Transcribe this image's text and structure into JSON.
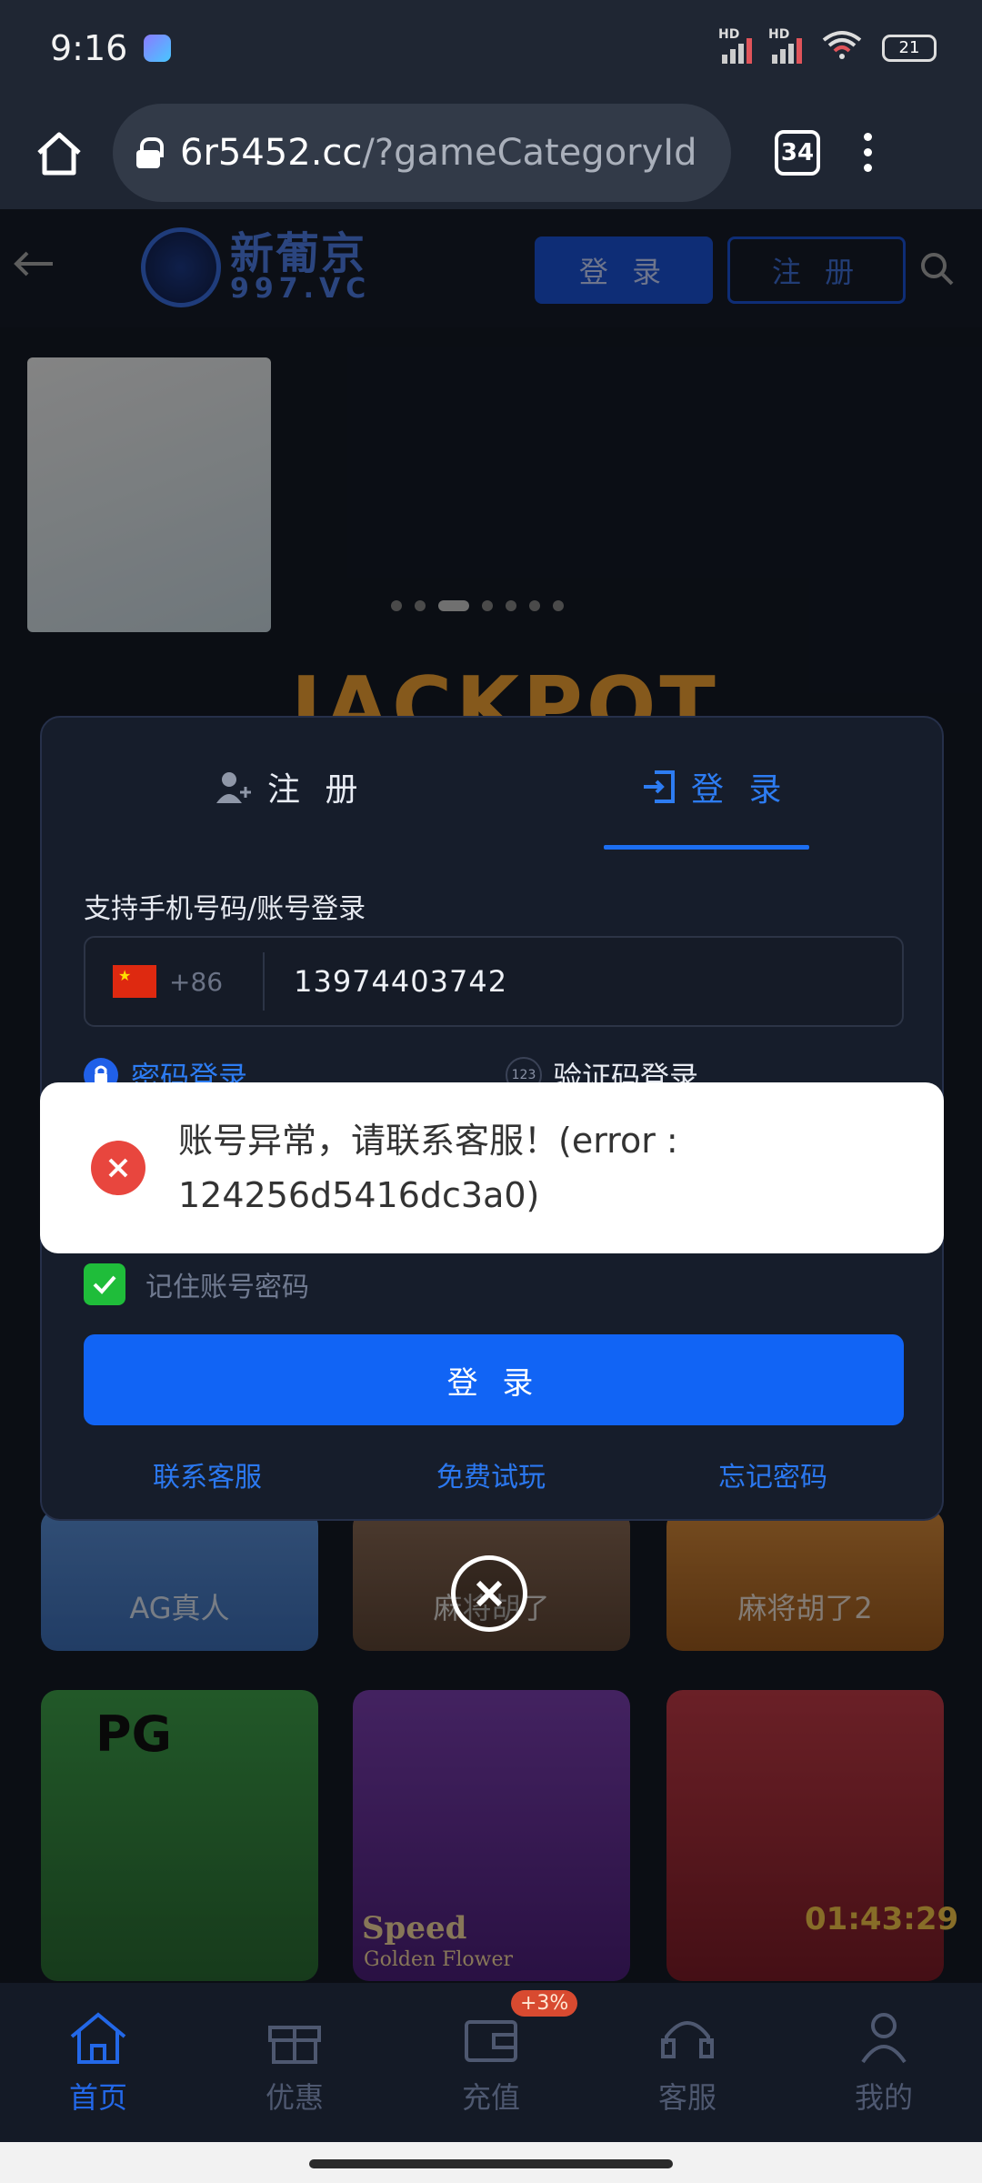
{
  "status_bar": {
    "time": "9:16",
    "battery": "21",
    "signal1_label": "HD",
    "signal2_label": "HD",
    "wifi_label": "6"
  },
  "browser": {
    "url_domain": "6r5452.cc",
    "url_path": "/?gameCategoryId",
    "tab_count": "34"
  },
  "site_header": {
    "logo_name": "新葡京",
    "logo_sub": "997.VC",
    "login_label": "登 录",
    "register_label": "注 册"
  },
  "background": {
    "jackpot_text": "JACKPOT",
    "games": [
      {
        "label": "AG真人"
      },
      {
        "label": "麻将胡了"
      },
      {
        "label": "麻将胡了2"
      }
    ],
    "pg_label": "PG",
    "speed_title": "Speed",
    "speed_sub": "Golden Flower",
    "timer": "01:43:29"
  },
  "modal": {
    "tab_register": "注 册",
    "tab_login": "登 录",
    "field_label": "支持手机号码/账号登录",
    "country_code": "+86",
    "phone_value": "13974403742",
    "mode_password": "密码登录",
    "mode_code": "验证码登录",
    "mode_code_icon_text": "123",
    "remember_label": "记住账号密码",
    "login_button": "登 录",
    "link_support": "联系客服",
    "link_trial": "免费试玩",
    "link_forgot": "忘记密码"
  },
  "toast": {
    "message": "账号异常，请联系客服！(error : 124256d5416dc3a0)"
  },
  "bottom_nav": {
    "items": [
      {
        "label": "首页"
      },
      {
        "label": "优惠"
      },
      {
        "label": "充值"
      },
      {
        "label": "客服"
      },
      {
        "label": "我的"
      }
    ],
    "recharge_badge": "+3%"
  },
  "colors": {
    "accent": "#1164f5",
    "error": "#e8463e",
    "check": "#1fbd3a"
  }
}
